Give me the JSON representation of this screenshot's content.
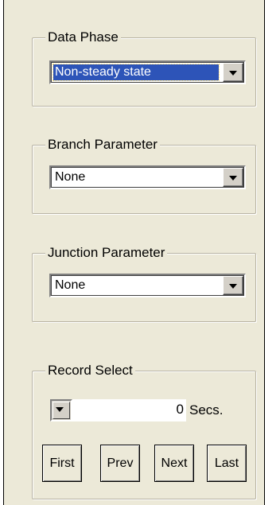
{
  "data_phase": {
    "title": "Data Phase",
    "selected": "Non-steady state"
  },
  "branch_parameter": {
    "title": "Branch Parameter",
    "selected": "None"
  },
  "junction_parameter": {
    "title": "Junction Parameter",
    "selected": "None"
  },
  "record_select": {
    "title": "Record Select",
    "value": "0",
    "units": "Secs.",
    "buttons": {
      "first": "First",
      "prev": "Prev",
      "next": "Next",
      "last": "Last"
    }
  },
  "icons": {
    "dropdown": "chevron-down-icon"
  },
  "colors": {
    "panel_bg": "#ece9d8",
    "selection_bg": "#2d54b8",
    "selection_text": "#ffffff"
  }
}
